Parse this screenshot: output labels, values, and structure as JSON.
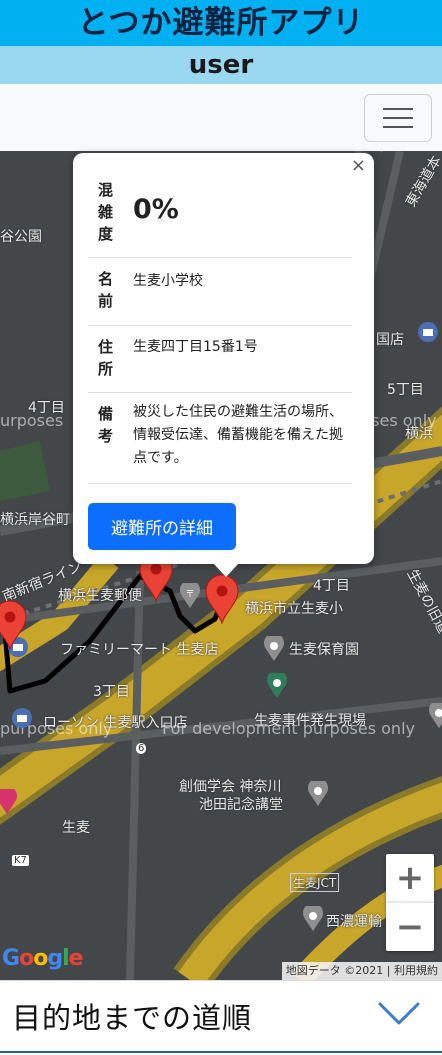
{
  "app": {
    "title": "とつか避難所アプリ",
    "user": "user"
  },
  "map": {
    "labels": [
      "谷公園",
      "4丁目",
      "5丁目",
      "国店",
      "横浜",
      "横浜岸谷町",
      "東海道本",
      "南新宿ライン",
      "横浜生麦郵便",
      "横浜市立生麦小",
      "4丁目",
      "生麦の旧道",
      "ファミリーマート 生麦店",
      "生麦保育園",
      "3丁目",
      "ローソン 生麦駅入口店",
      "生麦事件発生現場",
      "創価学会 神奈川",
      "池田記念講堂",
      "生麦",
      "生麦JCT",
      "西濃運輸",
      "K7",
      "6"
    ],
    "watermarks": [
      "urposes",
      "ent purposes only",
      "purposes only",
      "For development purposes only"
    ],
    "attribution": "地図データ ©2021 | 利用規約",
    "google": [
      "G",
      "o",
      "o",
      "g",
      "l",
      "e"
    ],
    "zoom_in": "+",
    "zoom_out": "−"
  },
  "popup": {
    "close": "×",
    "rows": [
      {
        "label": "混雑度",
        "value": "0%"
      },
      {
        "label": "名前",
        "value": "生麦小学校"
      },
      {
        "label": "住所",
        "value": "生麦四丁目15番1号"
      },
      {
        "label": "備考",
        "value": "被災した住民の避難生活の場所、情報受伝達、備蓄機能を備えた拠点です。"
      }
    ],
    "button": "避難所の詳細"
  },
  "bottom": {
    "label": "目的地までの道順",
    "chevron": "chevron-down-icon"
  },
  "colors": {
    "title_bg": "#00b0f0",
    "user_bg": "#9ad8f2",
    "button": "#0d6efd",
    "marker": "#ea4335"
  }
}
